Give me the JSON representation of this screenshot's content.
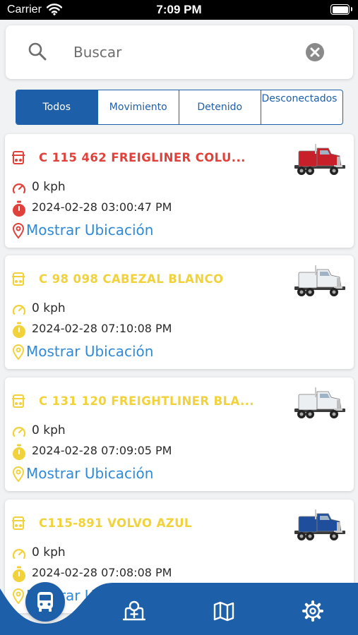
{
  "status_bar": {
    "carrier": "Carrier",
    "time": "7:09 PM"
  },
  "search": {
    "placeholder": "Buscar"
  },
  "filters": {
    "tabs": [
      {
        "label": "Todos",
        "active": true
      },
      {
        "label": "Movimiento",
        "active": false
      },
      {
        "label": "Detenido",
        "active": false
      },
      {
        "label": "Desconectados",
        "active": false
      }
    ]
  },
  "vehicles": [
    {
      "name": "C 115 462 FREIGLINER  COLU...",
      "status_color": "#e0413a",
      "speed": "0 kph",
      "timestamp": "2024-02-28 03:00:47 PM",
      "location_label": "Mostrar Ubicación",
      "truck_color": "#c8202a"
    },
    {
      "name": "C  98 098 CABEZAL  BLANCO",
      "status_color": "#f1d23a",
      "speed": "0 kph",
      "timestamp": "2024-02-28 07:10:08 PM",
      "location_label": "Mostrar Ubicación",
      "truck_color": "#eceff1"
    },
    {
      "name": "C 131 120  FREIGHTLINER BLA...",
      "status_color": "#f1d23a",
      "speed": "0 kph",
      "timestamp": "2024-02-28 07:09:05 PM",
      "location_label": "Mostrar Ubicación",
      "truck_color": "#eceff1"
    },
    {
      "name": "C115-891 VOLVO AZUL",
      "status_color": "#f1d23a",
      "speed": "0 kph",
      "timestamp": "2024-02-28 07:08:08 PM",
      "location_label": "Mostrar Ubicación",
      "truck_color": "#1f4f9c"
    }
  ],
  "colors": {
    "primary": "#1d5fa9",
    "link": "#2f8ad9",
    "offline": "#e0413a",
    "stopped": "#f1d23a"
  },
  "bottom_nav": {
    "items": [
      "bus-icon",
      "hospital-plus-icon",
      "map-icon",
      "settings-gear-icon"
    ],
    "active": "bus-icon"
  }
}
